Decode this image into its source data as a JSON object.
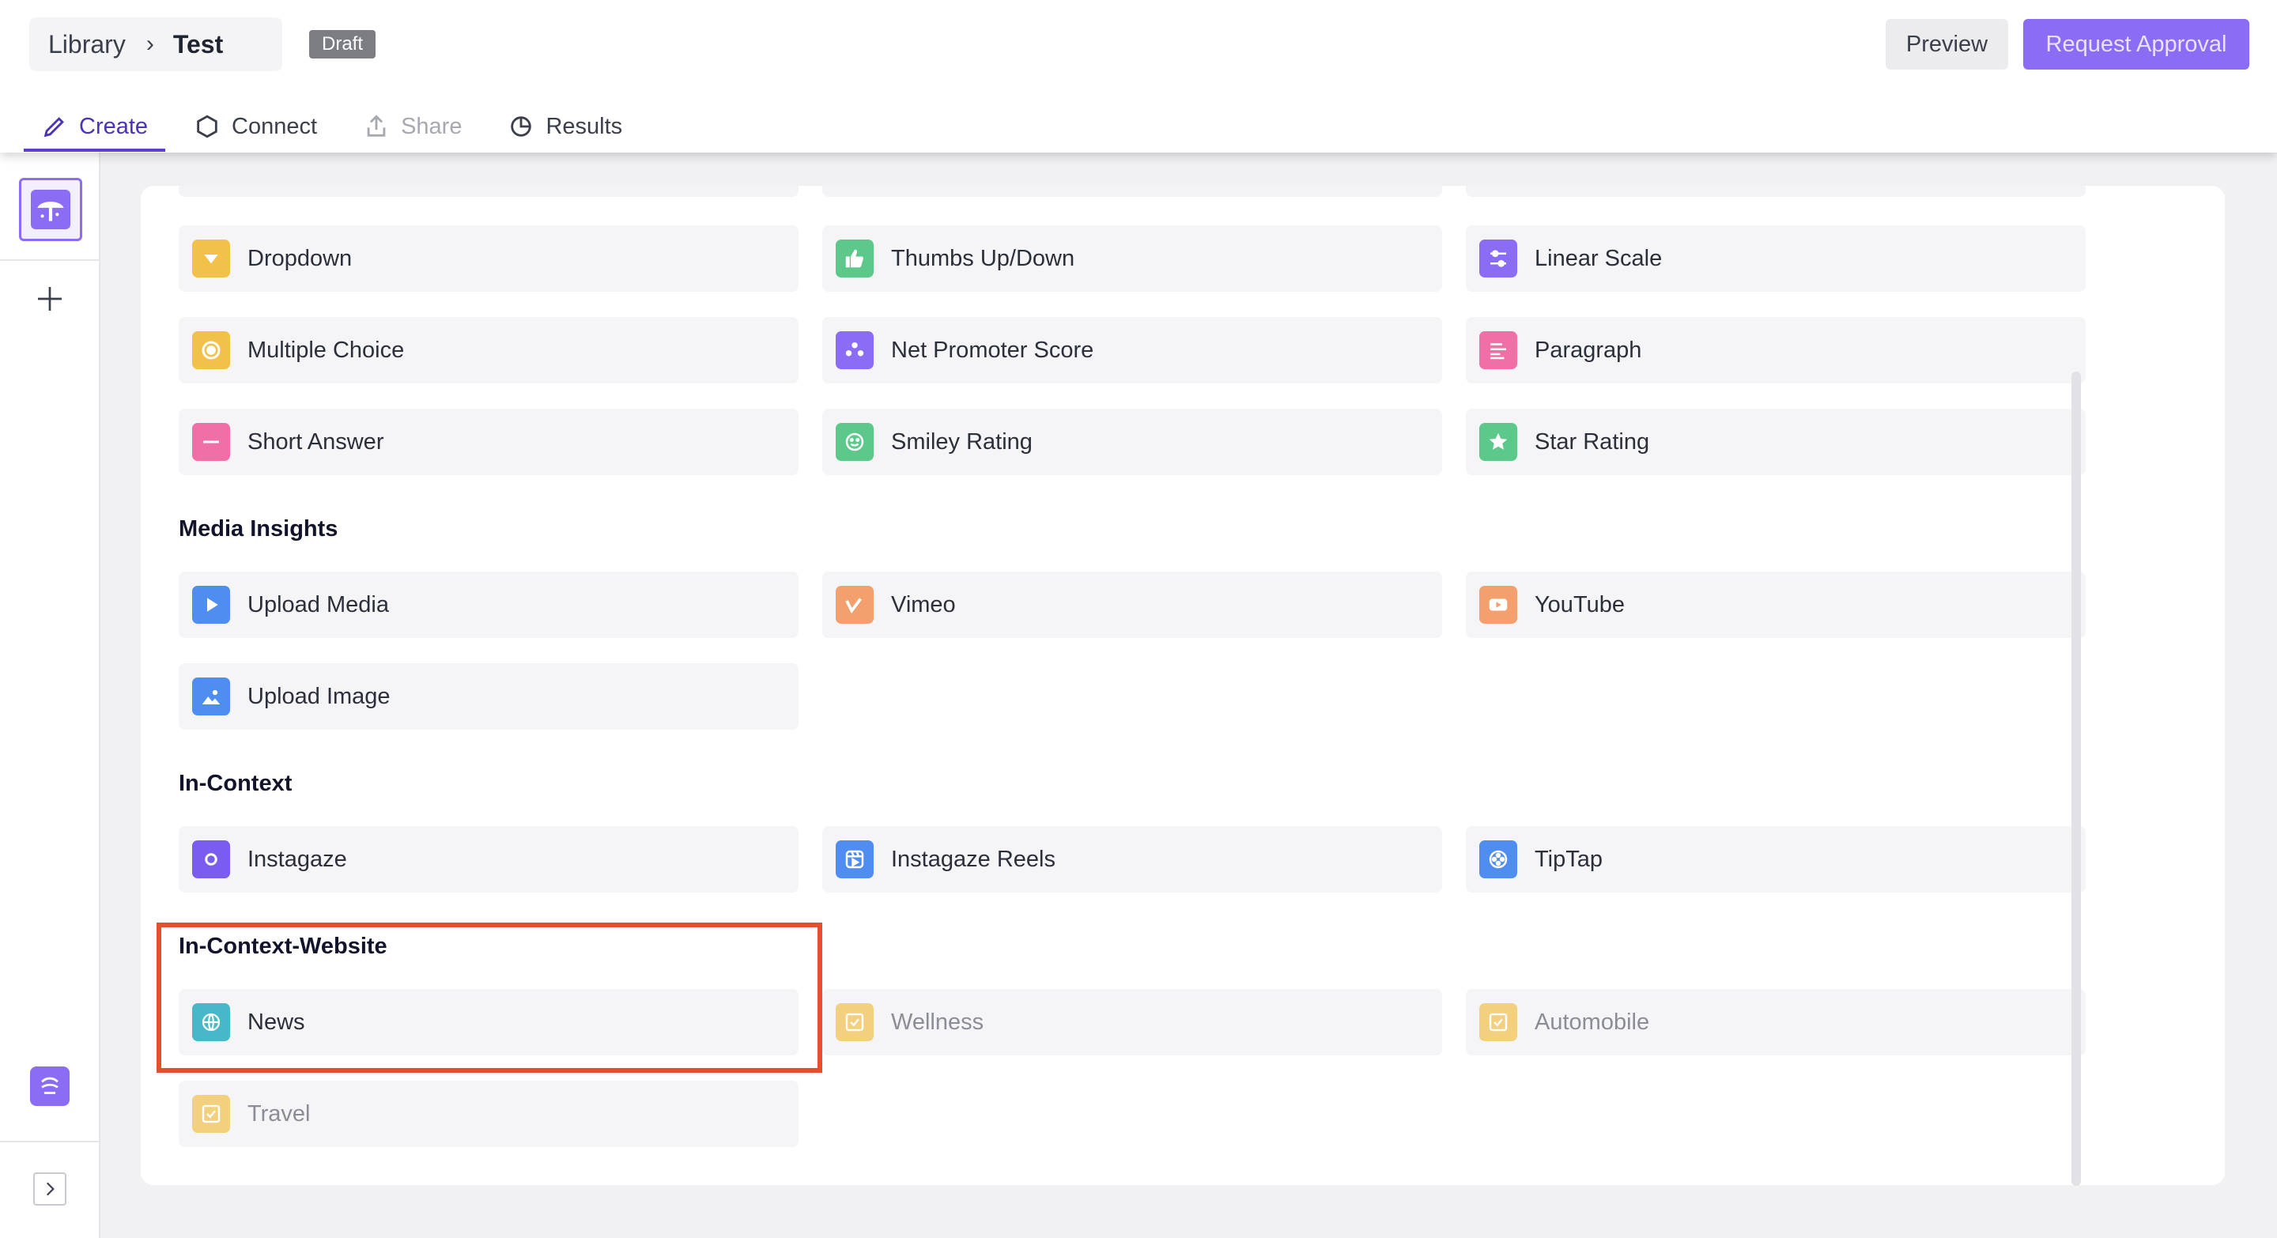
{
  "breadcrumb": {
    "library": "Library",
    "current": "Test"
  },
  "status_badge": "Draft",
  "header_buttons": {
    "preview": "Preview",
    "request_approval": "Request Approval"
  },
  "tabs": [
    {
      "label": "Create",
      "icon": "pencil-icon",
      "active": true
    },
    {
      "label": "Connect",
      "icon": "hexagon-icon"
    },
    {
      "label": "Share",
      "icon": "share-upload-icon",
      "disabled": true
    },
    {
      "label": "Results",
      "icon": "pie-chart-icon"
    }
  ],
  "colors": {
    "accent": "#8b6cf5",
    "accent_dark": "#5b3fd1",
    "highlight_border": "#e5502c",
    "yellow": "#f2c14a",
    "green": "#5cc98b",
    "purple": "#8b6cf5",
    "pink": "#ef6fa6",
    "blue": "#4f8df0",
    "orange": "#f3a06e",
    "teal": "#47b8c8"
  },
  "question_types": [
    {
      "label": "Dropdown",
      "icon": "dropdown-icon",
      "color": "#f2c14a"
    },
    {
      "label": "Thumbs Up/Down",
      "icon": "thumbs-up-icon",
      "color": "#5cc98b"
    },
    {
      "label": "Linear Scale",
      "icon": "sliders-icon",
      "color": "#8b6cf5"
    },
    {
      "label": "Multiple Choice",
      "icon": "radio-icon",
      "color": "#f2c14a"
    },
    {
      "label": "Net Promoter Score",
      "icon": "nps-dial-icon",
      "color": "#8b6cf5"
    },
    {
      "label": "Paragraph",
      "icon": "paragraph-icon",
      "color": "#ef6fa6"
    },
    {
      "label": "Short Answer",
      "icon": "short-answer-icon",
      "color": "#ef6fa6"
    },
    {
      "label": "Smiley Rating",
      "icon": "smiley-icon",
      "color": "#5cc98b"
    },
    {
      "label": "Star Rating",
      "icon": "star-icon",
      "color": "#5cc98b"
    }
  ],
  "sections": {
    "media_insights": {
      "title": "Media Insights",
      "items": [
        {
          "label": "Upload Media",
          "icon": "play-icon",
          "color": "#4f8df0"
        },
        {
          "label": "Vimeo",
          "icon": "vimeo-icon",
          "color": "#f3a06e"
        },
        {
          "label": "YouTube",
          "icon": "youtube-icon",
          "color": "#f3a06e"
        },
        {
          "label": "Upload Image",
          "icon": "image-icon",
          "color": "#4f8df0"
        }
      ]
    },
    "in_context": {
      "title": "In-Context",
      "items": [
        {
          "label": "Instagaze",
          "icon": "instagram-icon",
          "color": "#7b5cf0"
        },
        {
          "label": "Instagaze Reels",
          "icon": "reels-icon",
          "color": "#4f8df0"
        },
        {
          "label": "TipTap",
          "icon": "tiptap-icon",
          "color": "#4f8df0"
        }
      ]
    },
    "in_context_website": {
      "title": "In-Context-Website",
      "items": [
        {
          "label": "News",
          "icon": "globe-icon",
          "color": "#47b8c8"
        },
        {
          "label": "Wellness",
          "icon": "checkbox-icon",
          "color": "#f2c14a"
        },
        {
          "label": "Automobile",
          "icon": "checkbox-icon",
          "color": "#f2c14a"
        },
        {
          "label": "Travel",
          "icon": "checkbox-icon",
          "color": "#f2c14a"
        }
      ]
    }
  }
}
